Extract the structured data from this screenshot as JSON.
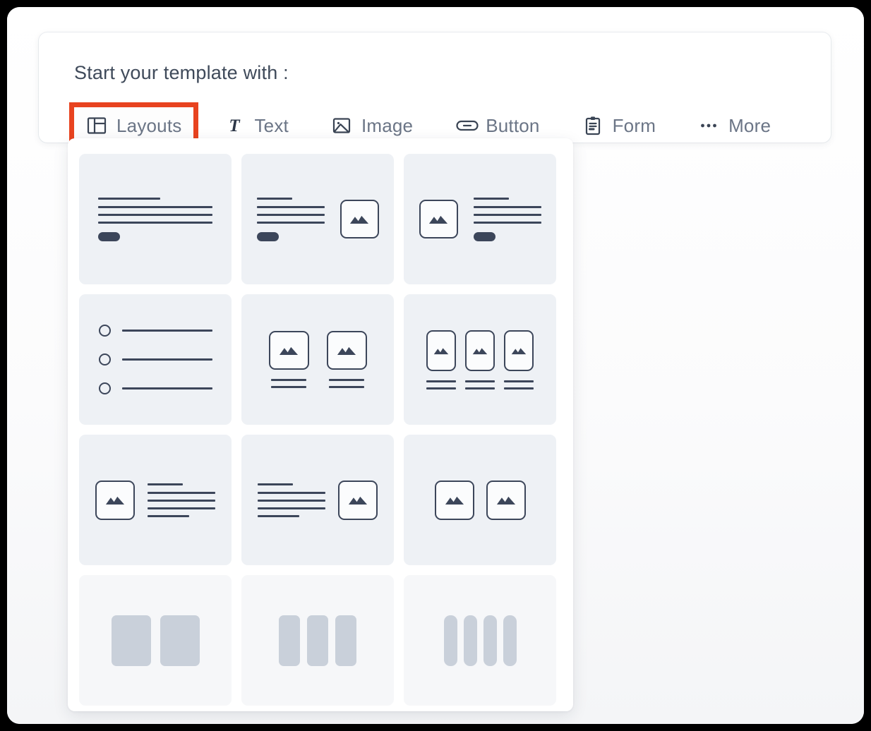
{
  "header": {
    "title": "Start your template with :"
  },
  "toolbar": {
    "selected": "Layouts",
    "highlight_color": "#e8431f",
    "items": [
      {
        "label": "Layouts",
        "icon": "layouts-icon",
        "selected": true
      },
      {
        "label": "Text",
        "icon": "text-icon",
        "selected": false
      },
      {
        "label": "Image",
        "icon": "image-icon",
        "selected": false
      },
      {
        "label": "Button",
        "icon": "button-icon",
        "selected": false
      },
      {
        "label": "Form",
        "icon": "form-icon",
        "selected": false
      },
      {
        "label": "More",
        "icon": "ellipsis-icon",
        "selected": false
      }
    ]
  },
  "layouts_panel": {
    "items": [
      {
        "name": "text-block-with-button",
        "description": "Heading, three text lines and a button"
      },
      {
        "name": "text-left-image-right-with-button",
        "description": "Text with button on the left, image on the right"
      },
      {
        "name": "image-left-text-right-with-button",
        "description": "Image on the left, text with button on the right"
      },
      {
        "name": "bulleted-list-three-items",
        "description": "Three bulleted list rows"
      },
      {
        "name": "two-images-with-captions",
        "description": "Two square images each with a two line caption"
      },
      {
        "name": "three-images-with-captions",
        "description": "Three portrait images each with a two line caption"
      },
      {
        "name": "image-left-paragraph-right",
        "description": "Image on the left, paragraph on the right"
      },
      {
        "name": "paragraph-left-image-right",
        "description": "Paragraph on the left, image on the right"
      },
      {
        "name": "two-images-side-by-side",
        "description": "Two square images side by side"
      },
      {
        "name": "two-column-blocks",
        "description": "Two solid column blocks"
      },
      {
        "name": "three-column-blocks",
        "description": "Three solid column blocks"
      },
      {
        "name": "four-column-blocks",
        "description": "Four solid column blocks"
      }
    ]
  },
  "colors": {
    "accent": "#e8431f",
    "ink": "#3c465a",
    "thumb_bg": "#eef1f5",
    "thumb_bg_plain": "#f6f7f9",
    "block_fill": "#c9d0da",
    "label": "#6b7586",
    "title": "#3f4a5a"
  }
}
